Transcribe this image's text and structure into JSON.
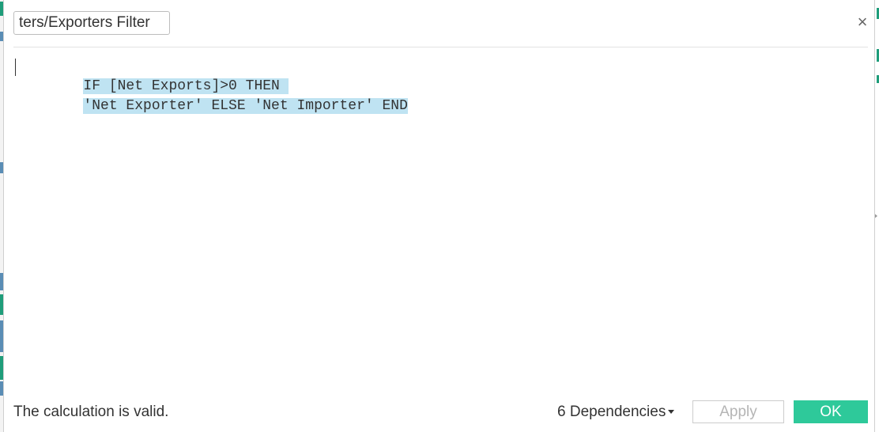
{
  "dialog": {
    "name_field_value": "ters/Exporters Filter",
    "close_glyph": "×"
  },
  "editor": {
    "lines": [
      "IF [Net Exports]>0 THEN ",
      "'Net Exporter' ELSE 'Net Importer' END"
    ],
    "selection_color": "#bfe3f2"
  },
  "footer": {
    "status_text": "The calculation is valid.",
    "dependencies_label": "6 Dependencies",
    "apply_label": "Apply",
    "ok_label": "OK"
  },
  "colors": {
    "ok_button": "#2ec99a",
    "apply_text_disabled": "#b5b5b5"
  }
}
